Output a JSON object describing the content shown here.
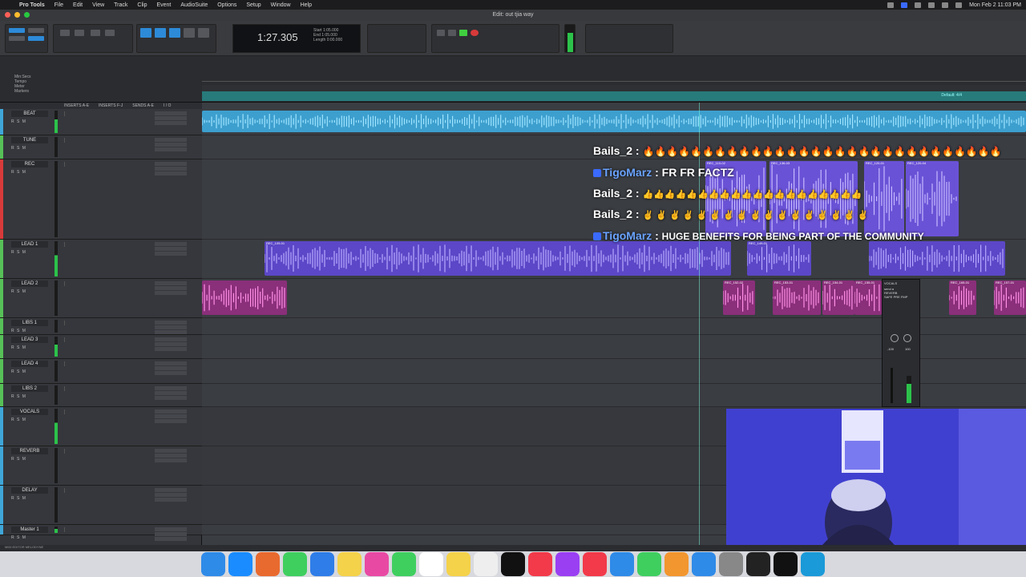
{
  "menubar": {
    "app": "Pro Tools",
    "items": [
      "File",
      "Edit",
      "View",
      "Track",
      "Clip",
      "Event",
      "AudioSuite",
      "Options",
      "Setup",
      "Window",
      "Help"
    ],
    "clock": "Mon Feb 2  11:03 PM"
  },
  "window": {
    "title": "Edit: out tjia way"
  },
  "counter": {
    "main": "1:27.305",
    "start_label": "Start",
    "end_label": "End",
    "length_label": "Length",
    "start": "1:05.000",
    "end": "1:05.000",
    "length": "0:00.000"
  },
  "rulers": [
    "Min:Secs",
    "Tempo",
    "Meter",
    "Markers"
  ],
  "marker_text": "Default: 4/4",
  "header_cols": [
    "INSERTS A-E",
    "INSERTS F-J",
    "SENDS A-E",
    "I / O"
  ],
  "tracks": [
    {
      "name": "BEAT",
      "color": "#3fa6d8",
      "height": 33
    },
    {
      "name": "TUNE",
      "color": "#57c057",
      "height": 30
    },
    {
      "name": "REC",
      "color": "#d83a3a",
      "height": 100
    },
    {
      "name": "LEAD 1",
      "color": "#57c057",
      "height": 49
    },
    {
      "name": "LEAD 2",
      "color": "#57c057",
      "height": 49
    },
    {
      "name": "LIBS 1",
      "color": "#57c057",
      "height": 21
    },
    {
      "name": "LEAD 3",
      "color": "#57c057",
      "height": 30
    },
    {
      "name": "LEAD 4",
      "color": "#57c057",
      "height": 31
    },
    {
      "name": "LIBS 2",
      "color": "#57c057",
      "height": 29
    },
    {
      "name": "VOCALS",
      "color": "#3fa6d8",
      "height": 49
    },
    {
      "name": "REVERB",
      "color": "#3fa6d8",
      "height": 49
    },
    {
      "name": "DELAY",
      "color": "#3fa6d8",
      "height": 49
    },
    {
      "name": "Master 1",
      "color": "#3fa6d8",
      "height": 13
    }
  ],
  "clips": {
    "rec_row": [
      "REC_110-02",
      "REC_136-03",
      "REC_120-01",
      "REC_120-04"
    ],
    "lead1": [
      "REC_109-01",
      "REC_149-01"
    ],
    "lead2": [
      "REC_152-02",
      "REC_153-01",
      "REC_154-01",
      "REC_155-01",
      "REC_165-01",
      "REC_157-01"
    ]
  },
  "chat": [
    {
      "user": "Bails_2",
      "message": "🔥🔥🔥🔥🔥🔥🔥🔥🔥🔥🔥🔥🔥🔥🔥🔥🔥🔥🔥🔥🔥🔥🔥🔥🔥🔥🔥🔥🔥🔥"
    },
    {
      "user": "TigoMarz",
      "message": "FR FR FACTZ"
    },
    {
      "user": "Bails_2",
      "message": "👍👍👍👍👍👍👍👍👍👍👍👍👍👍👍👍👍👍👍👍"
    },
    {
      "user": "Bails_2",
      "message": "✌️ ✌️ ✌️ ✌️ ✌️ ✌️ ✌️ ✌️ ✌️ ✌️ ✌️ ✌️ ✌️ ✌️ ✌️ ✌️ ✌️"
    },
    {
      "user": "TigoMarz",
      "message": "HUGE BENEFITS FOR BEING PART OF THE COMMUNITY"
    }
  ],
  "mixer_pop": {
    "track": "VOCALS",
    "send": "send a",
    "reverb": "REVERB",
    "safe": "SAFE",
    "pre": "PRE",
    "fmp": "FMP",
    "value": "-100",
    "pan": "100"
  },
  "dock": [
    "Finder",
    "Safari",
    "Launchpad",
    "Messages",
    "Mail",
    "Notes",
    "Photos",
    "FaceTime",
    "Calendar",
    "Stickies",
    "TextEdit",
    "TV",
    "Music",
    "Podcasts",
    "News",
    "Keynote",
    "Numbers",
    "Pages",
    "App Store",
    "System Settings",
    "Pro Tools",
    "iLok",
    "Loopback"
  ],
  "status": "MIDI EDITOR   MELODYNE"
}
